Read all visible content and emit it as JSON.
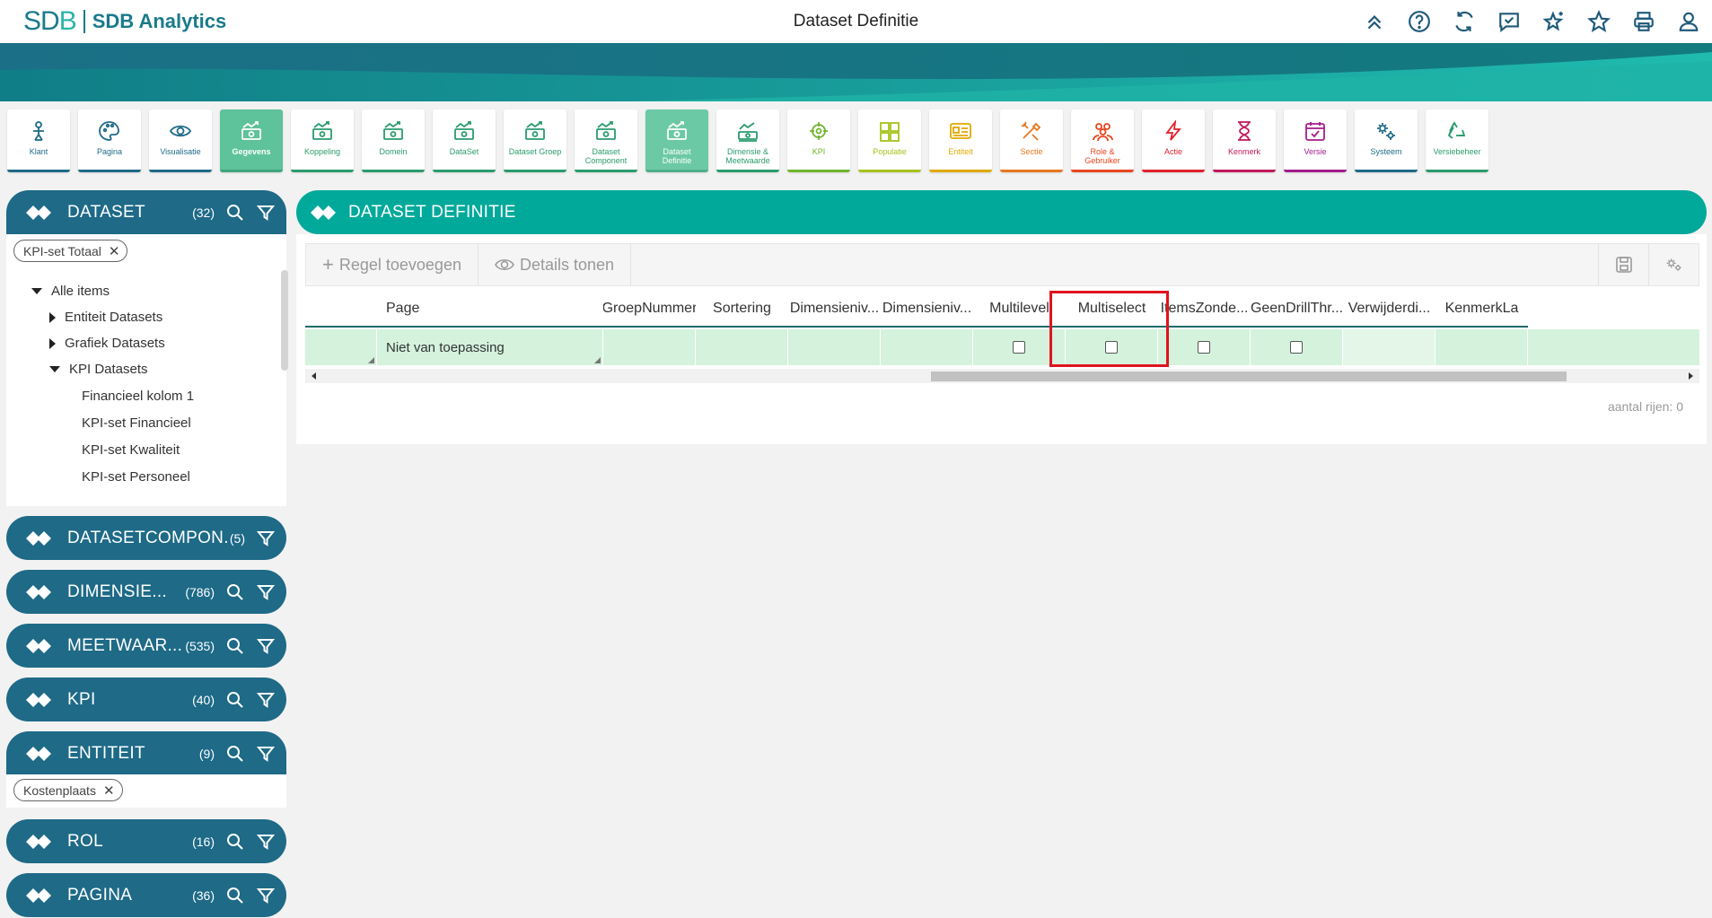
{
  "app": {
    "logo_mark": "SDB",
    "logo_text": "SDB Analytics",
    "page_title": "Dataset Definitie"
  },
  "top_icons": [
    "chevrons-up-icon",
    "help-icon",
    "refresh-icon",
    "feedback-icon",
    "sparkle-star-icon",
    "star-icon",
    "print-icon",
    "user-icon"
  ],
  "tiles": [
    {
      "label": "Klant",
      "color": "#1e6a87",
      "icon": "klant"
    },
    {
      "label": "Pagina",
      "color": "#1e6a87",
      "icon": "pagina"
    },
    {
      "label": "Visualisatie",
      "color": "#1e6a87",
      "icon": "eye"
    },
    {
      "label": "Gegevens",
      "color": "#2a9b6d",
      "icon": "money",
      "state": "active"
    },
    {
      "label": "Koppeling",
      "color": "#2a9b6d",
      "icon": "money"
    },
    {
      "label": "Domein",
      "color": "#2a9b6d",
      "icon": "money"
    },
    {
      "label": "DataSet",
      "color": "#2a9b6d",
      "icon": "money"
    },
    {
      "label": "Dataset Groep",
      "color": "#2a9b6d",
      "icon": "money"
    },
    {
      "label": "Dataset Component",
      "color": "#2a9b6d",
      "icon": "money"
    },
    {
      "label": "Dataset Definitie",
      "color": "#2a9b6d",
      "icon": "money",
      "state": "active2"
    },
    {
      "label": "Dimensie & Meetwaarde",
      "color": "#2a9b6d",
      "icon": "dimension"
    },
    {
      "label": "KPI",
      "color": "#6fb52c",
      "icon": "target"
    },
    {
      "label": "Populatie",
      "color": "#a6c21b",
      "icon": "puzzle"
    },
    {
      "label": "Entiteit",
      "color": "#e0a800",
      "icon": "card"
    },
    {
      "label": "Sectie",
      "color": "#e8761e",
      "icon": "tools"
    },
    {
      "label": "Role & Gebruiker",
      "color": "#e8451e",
      "icon": "users"
    },
    {
      "label": "Actie",
      "color": "#e0202a",
      "icon": "bolt"
    },
    {
      "label": "Kenmerk",
      "color": "#c2185b",
      "icon": "hourglass"
    },
    {
      "label": "Versie",
      "color": "#a31d8c",
      "icon": "calendar"
    },
    {
      "label": "Systeem",
      "color": "#1e6a87",
      "icon": "gears"
    },
    {
      "label": "Versiebeheer",
      "color": "#2a9b6d",
      "icon": "recycle"
    }
  ],
  "panels": [
    {
      "title": "DATASET",
      "count": "(32)",
      "search": true
    },
    {
      "title": "DATASETCOMPON...",
      "count": "(5)",
      "search": false
    },
    {
      "title": "DIMENSIE...",
      "count": "(786)",
      "search": true
    },
    {
      "title": "MEETWAAR...",
      "count": "(535)",
      "search": true
    },
    {
      "title": "KPI",
      "count": "(40)",
      "search": true
    },
    {
      "title": "ENTITEIT",
      "count": "(9)",
      "search": true
    },
    {
      "title": "ROL",
      "count": "(16)",
      "search": true
    },
    {
      "title": "PAGINA",
      "count": "(36)",
      "search": true
    }
  ],
  "dataset_filter_chip": "KPI-set Totaal",
  "entiteit_filter_chip": "Kostenplaats",
  "tree": {
    "root": "Alle items",
    "items": [
      "Entiteit Datasets",
      "Grafiek Datasets",
      "KPI Datasets"
    ],
    "children": [
      "Financieel kolom 1",
      "KPI-set Financieel",
      "KPI-set Kwaliteit",
      "KPI-set Personeel"
    ]
  },
  "main": {
    "title": "DATASET DEFINITIE",
    "add_row": "Regel toevoegen",
    "show_details": "Details tonen",
    "columns": [
      "Page",
      "GroepNummer",
      "Sortering",
      "Dimensieniv...",
      "Dimensieniv...",
      "Multilevel",
      "Multiselect",
      "ItemsZonde...",
      "GeenDrillThr...",
      "Verwijderdi...",
      "KenmerkLa"
    ],
    "row": {
      "page": "Niet van toepassing"
    },
    "row_count": "aantal rijen: 0"
  }
}
